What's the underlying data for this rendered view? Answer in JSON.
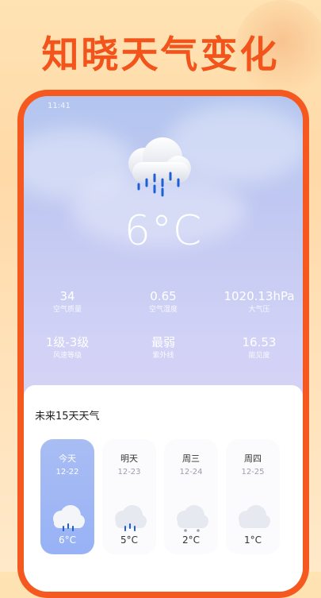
{
  "promo": {
    "title": "知晓天气变化"
  },
  "status_bar": {
    "time": "11:41"
  },
  "current": {
    "temperature": "6°C",
    "stats": [
      {
        "value": "34",
        "label": "空气质量"
      },
      {
        "value": "0.65",
        "label": "空气湿度"
      },
      {
        "value": "1020.13hPa",
        "label": "大气压"
      },
      {
        "value": "1级-3级",
        "label": "风速等级"
      },
      {
        "value": "最弱",
        "label": "紫外线"
      },
      {
        "value": "16.53",
        "label": "能见度"
      }
    ],
    "icon": "rain-cloud-icon"
  },
  "forecast": {
    "title": "未来15天天气",
    "days": [
      {
        "name": "今天",
        "date": "12-22",
        "temp": "6°C",
        "icon": "rain-cloud-icon",
        "active": true
      },
      {
        "name": "明天",
        "date": "12-23",
        "temp": "5°C",
        "icon": "rain-cloud-icon"
      },
      {
        "name": "周三",
        "date": "12-24",
        "temp": "2°C",
        "icon": "snow-cloud-icon"
      },
      {
        "name": "周四",
        "date": "12-25",
        "temp": "1°C",
        "icon": "cloud-icon"
      }
    ]
  },
  "colors": {
    "accent": "#f6591f",
    "rain": "#1e5fd8"
  }
}
